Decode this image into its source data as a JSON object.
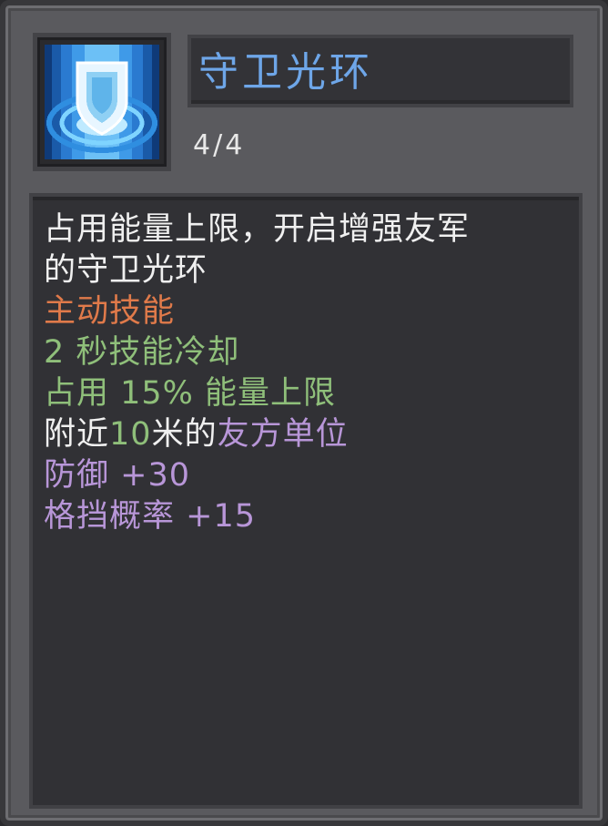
{
  "skill": {
    "name": "守卫光环",
    "level": "4/4",
    "icon": "shield-aura-icon"
  },
  "description": {
    "line1": "占用能量上限，开启增强友军",
    "line2": "的守卫光环",
    "type": "主动技能",
    "cooldown": "2 秒技能冷却",
    "cost": "占用 15% 能量上限",
    "range_prefix": "附近",
    "range_value": "10",
    "range_suffix": "米的",
    "range_target": "友方单位",
    "bonus_defense": "防御 +30",
    "bonus_block": "格挡概率 +15"
  },
  "colors": {
    "title": "#6ea6e8",
    "normal": "#f0f0f0",
    "skill_type": "#e07a4a",
    "stat": "#8fbf7a",
    "target": "#b896d8"
  }
}
